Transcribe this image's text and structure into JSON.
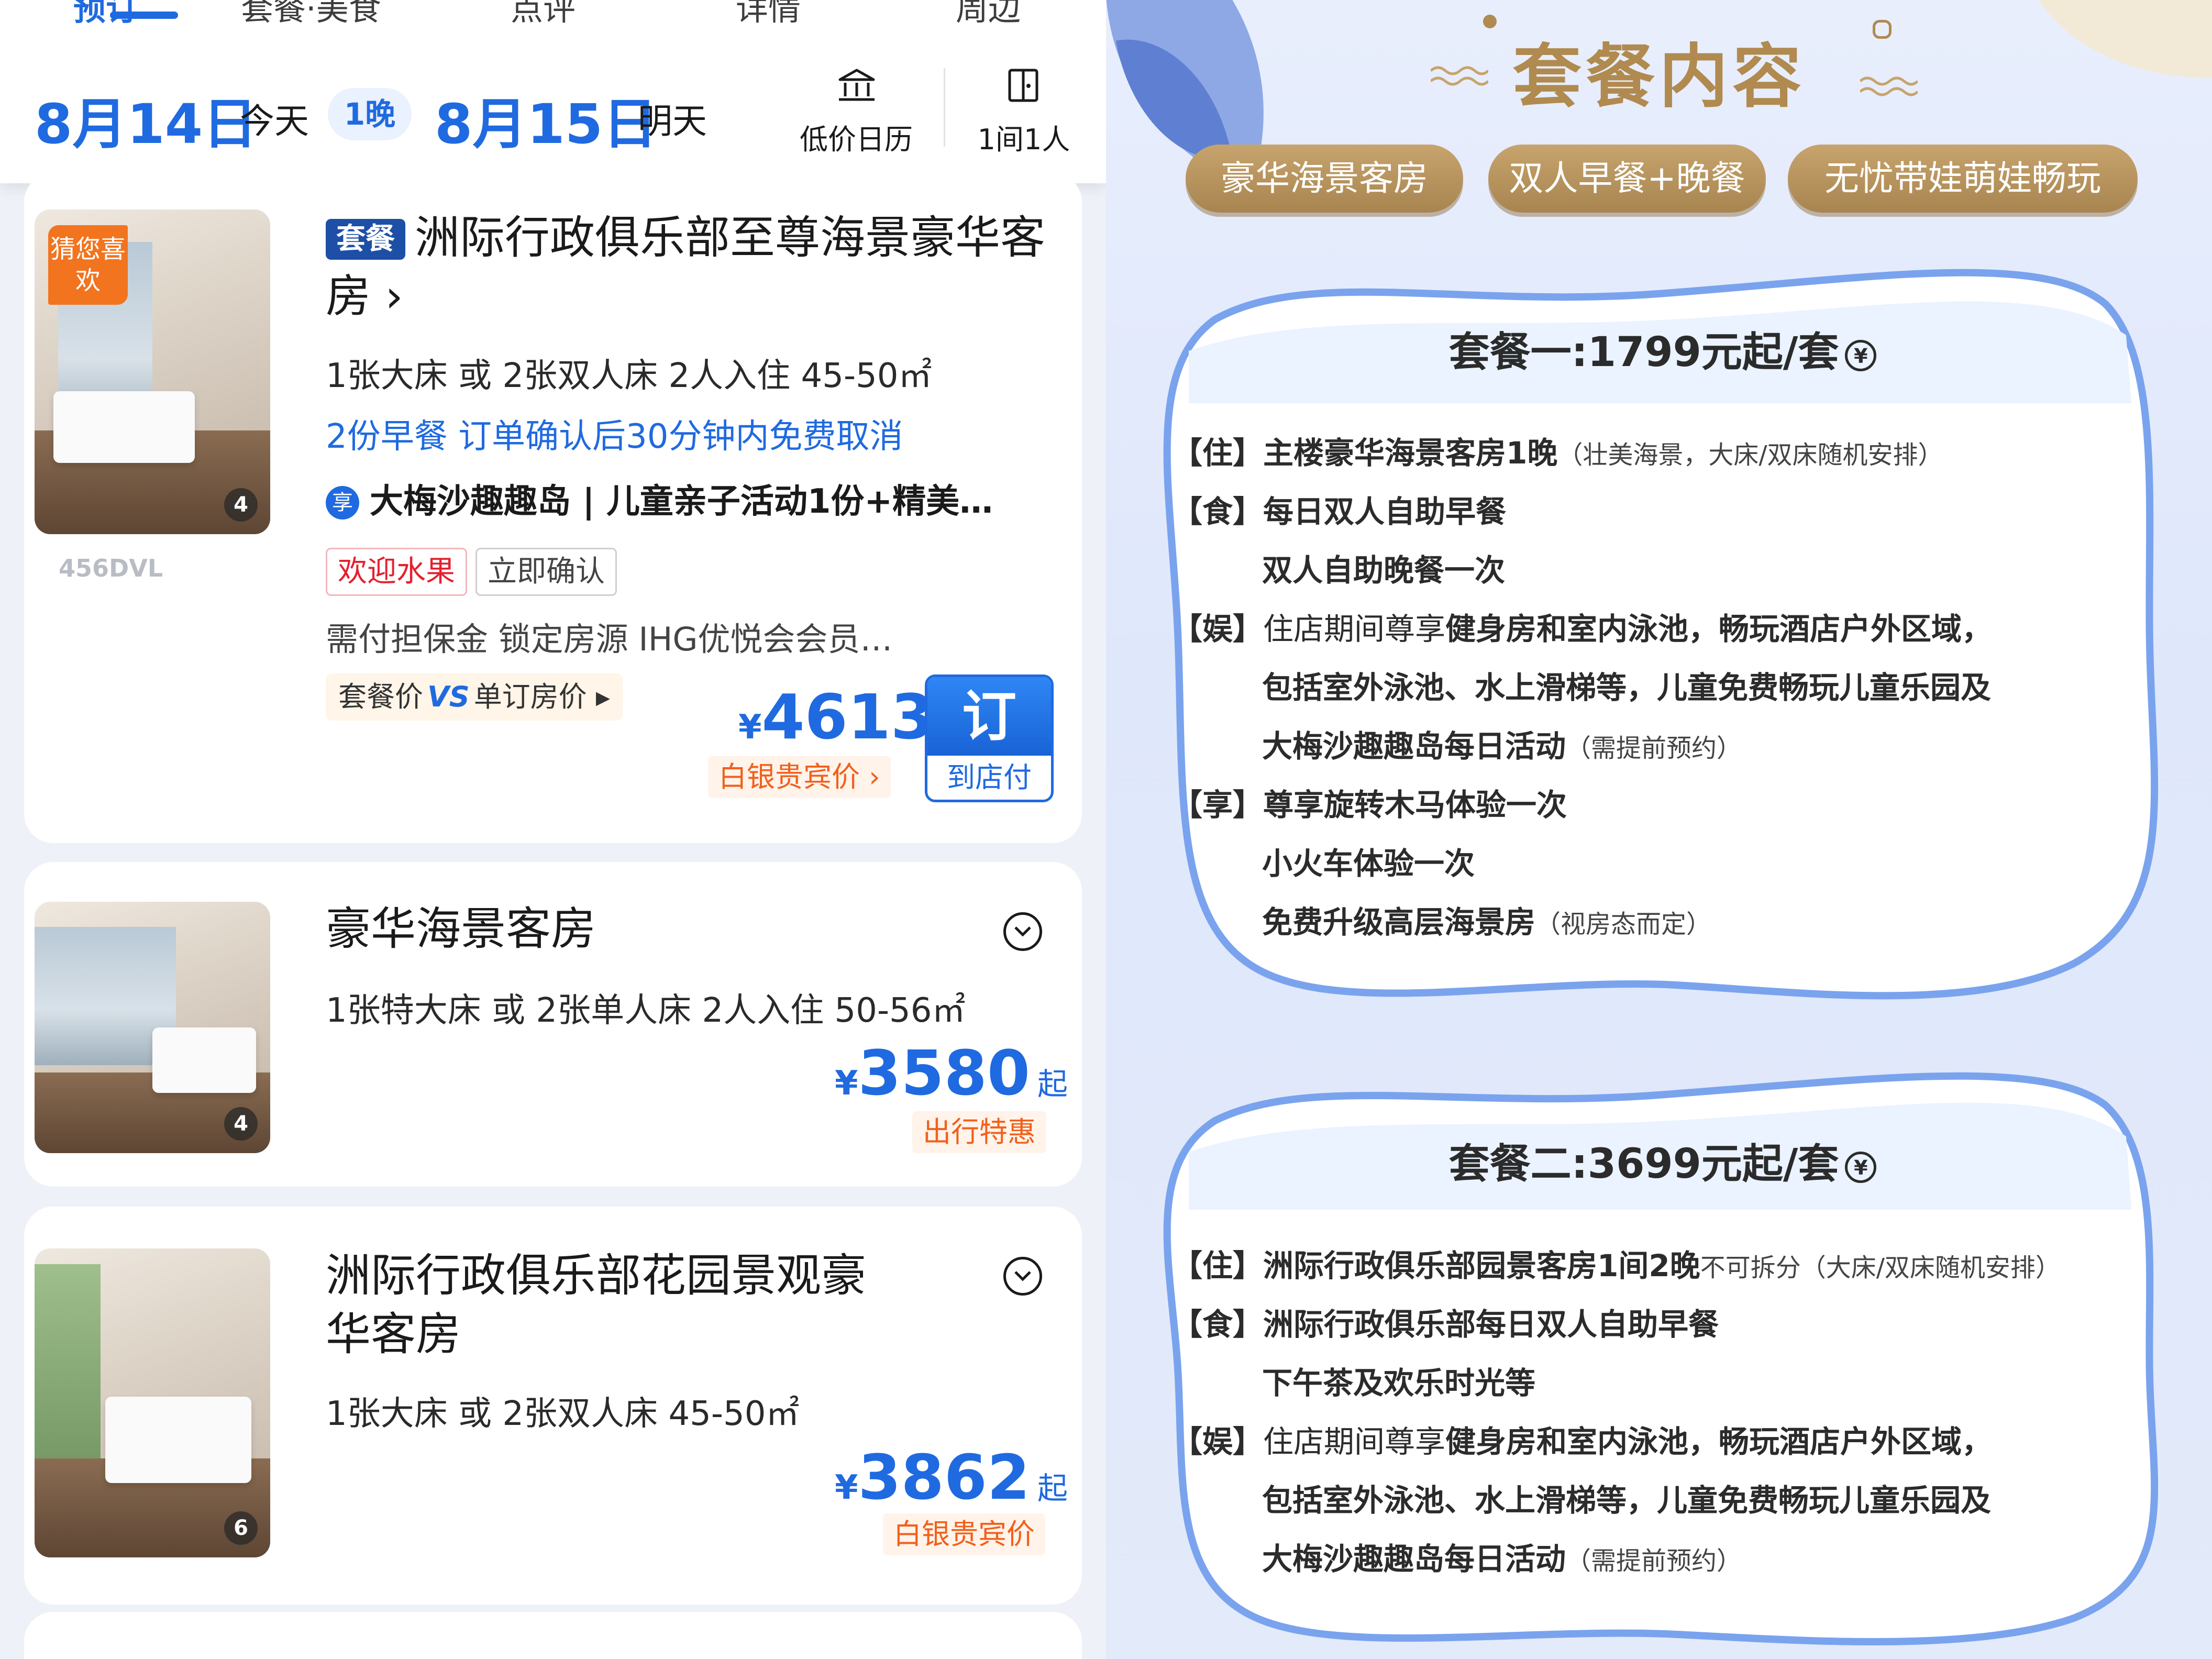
{
  "topbar": {
    "tabs": [
      "预订",
      "套餐·美食",
      "点评",
      "详情",
      "周边"
    ],
    "checkin_date": "8月14日",
    "checkin_day": "今天",
    "nights": "1晚",
    "checkout_date": "8月15日",
    "checkout_day": "明天",
    "calendar_label": "低价日历",
    "rooms_label": "1间1人"
  },
  "cards": [
    {
      "badge": "套餐",
      "title": "洲际行政俱乐部至尊海景豪华客房",
      "guess_label": "猜您喜欢",
      "image_count": "4",
      "watermark": "456DVL",
      "spec": "1张大床 或 2张双人床  2人入住  45-50㎡",
      "benefits": "2份早餐  订单确认后30分钟内免费取消",
      "perk_icon": "享",
      "perk": "大梅沙趣趣岛 | 儿童亲子活动1份+精美…",
      "tags": [
        "欢迎水果",
        "立即确认"
      ],
      "note": "需付担保金 锁定房源  IHG优悦会会员…",
      "compare": {
        "left": "套餐价",
        "vs": "VS",
        "right": "单订房价"
      },
      "price_symbol": "¥",
      "price": "4613",
      "member_label": "白银贵宾价",
      "book_label": "订",
      "pay_label": "到店付"
    },
    {
      "title": "豪华海景客房",
      "image_count": "4",
      "spec": "1张特大床 或 2张单人床  2人入住  50-56㎡",
      "price_symbol": "¥",
      "price": "3580",
      "price_suffix": "起",
      "member_label": "出行特惠"
    },
    {
      "title_line1": "洲际行政俱乐部花园景观豪",
      "title_line2": "华客房",
      "image_count": "6",
      "spec": "1张大床 或 2张双人床  45-50㎡",
      "price_symbol": "¥",
      "price": "3862",
      "price_suffix": "起",
      "member_label": "白银贵宾价"
    }
  ],
  "package": {
    "header": "套餐内容",
    "pills": [
      "豪华海景客房",
      "双人早餐+晚餐",
      "无忧带娃萌娃畅玩"
    ],
    "yuan_symbol": "¥",
    "plans": [
      {
        "title": "套餐一:1799元起/套",
        "lines": [
          {
            "lead": "【住】",
            "bold": "主楼豪华海景客房1晚",
            "plain": "",
            "small": "（壮美海景，大床/双床随机安排）"
          },
          {
            "lead": "【食】",
            "bold": "每日双人自助早餐",
            "plain": "",
            "small": ""
          },
          {
            "lead": "",
            "bold": "双人自助晚餐一次",
            "plain": "",
            "small": ""
          },
          {
            "lead": "【娱】",
            "plain": "住店期间尊享",
            "bold": "健身房和室内泳池，畅玩酒店户外区域，",
            "small": ""
          },
          {
            "lead": "",
            "bold": "包括室外泳池、水上滑梯等，儿童免费畅玩儿童乐园及",
            "plain": "",
            "small": ""
          },
          {
            "lead": "",
            "bold": "大梅沙趣趣岛每日活动",
            "plain": "",
            "small": "（需提前预约）"
          },
          {
            "lead": "【享】",
            "bold": "尊享旋转木马体验一次",
            "plain": "",
            "small": ""
          },
          {
            "lead": "",
            "bold": "小火车体验一次",
            "plain": "",
            "small": ""
          },
          {
            "lead": "",
            "bold": "免费升级高层海景房",
            "plain": "",
            "small": "（视房态而定）"
          }
        ]
      },
      {
        "title": "套餐二:3699元起/套",
        "lines": [
          {
            "lead": "【住】",
            "bold": "洲际行政俱乐部园景客房1间2晚",
            "plain": "",
            "small": "不可拆分（大床/双床随机安排）"
          },
          {
            "lead": "【食】",
            "bold": "洲际行政俱乐部每日双人自助早餐",
            "plain": "",
            "small": ""
          },
          {
            "lead": "",
            "bold": "下午茶及欢乐时光等",
            "plain": "",
            "small": ""
          },
          {
            "lead": "【娱】",
            "plain": "住店期间尊享",
            "bold": "健身房和室内泳池，畅玩酒店户外区域，",
            "small": ""
          },
          {
            "lead": "",
            "bold": "包括室外泳池、水上滑梯等，儿童免费畅玩儿童乐园及",
            "plain": "",
            "small": ""
          },
          {
            "lead": "",
            "bold": "大梅沙趣趣岛每日活动",
            "plain": "",
            "small": "（需提前预约）"
          }
        ]
      }
    ]
  }
}
